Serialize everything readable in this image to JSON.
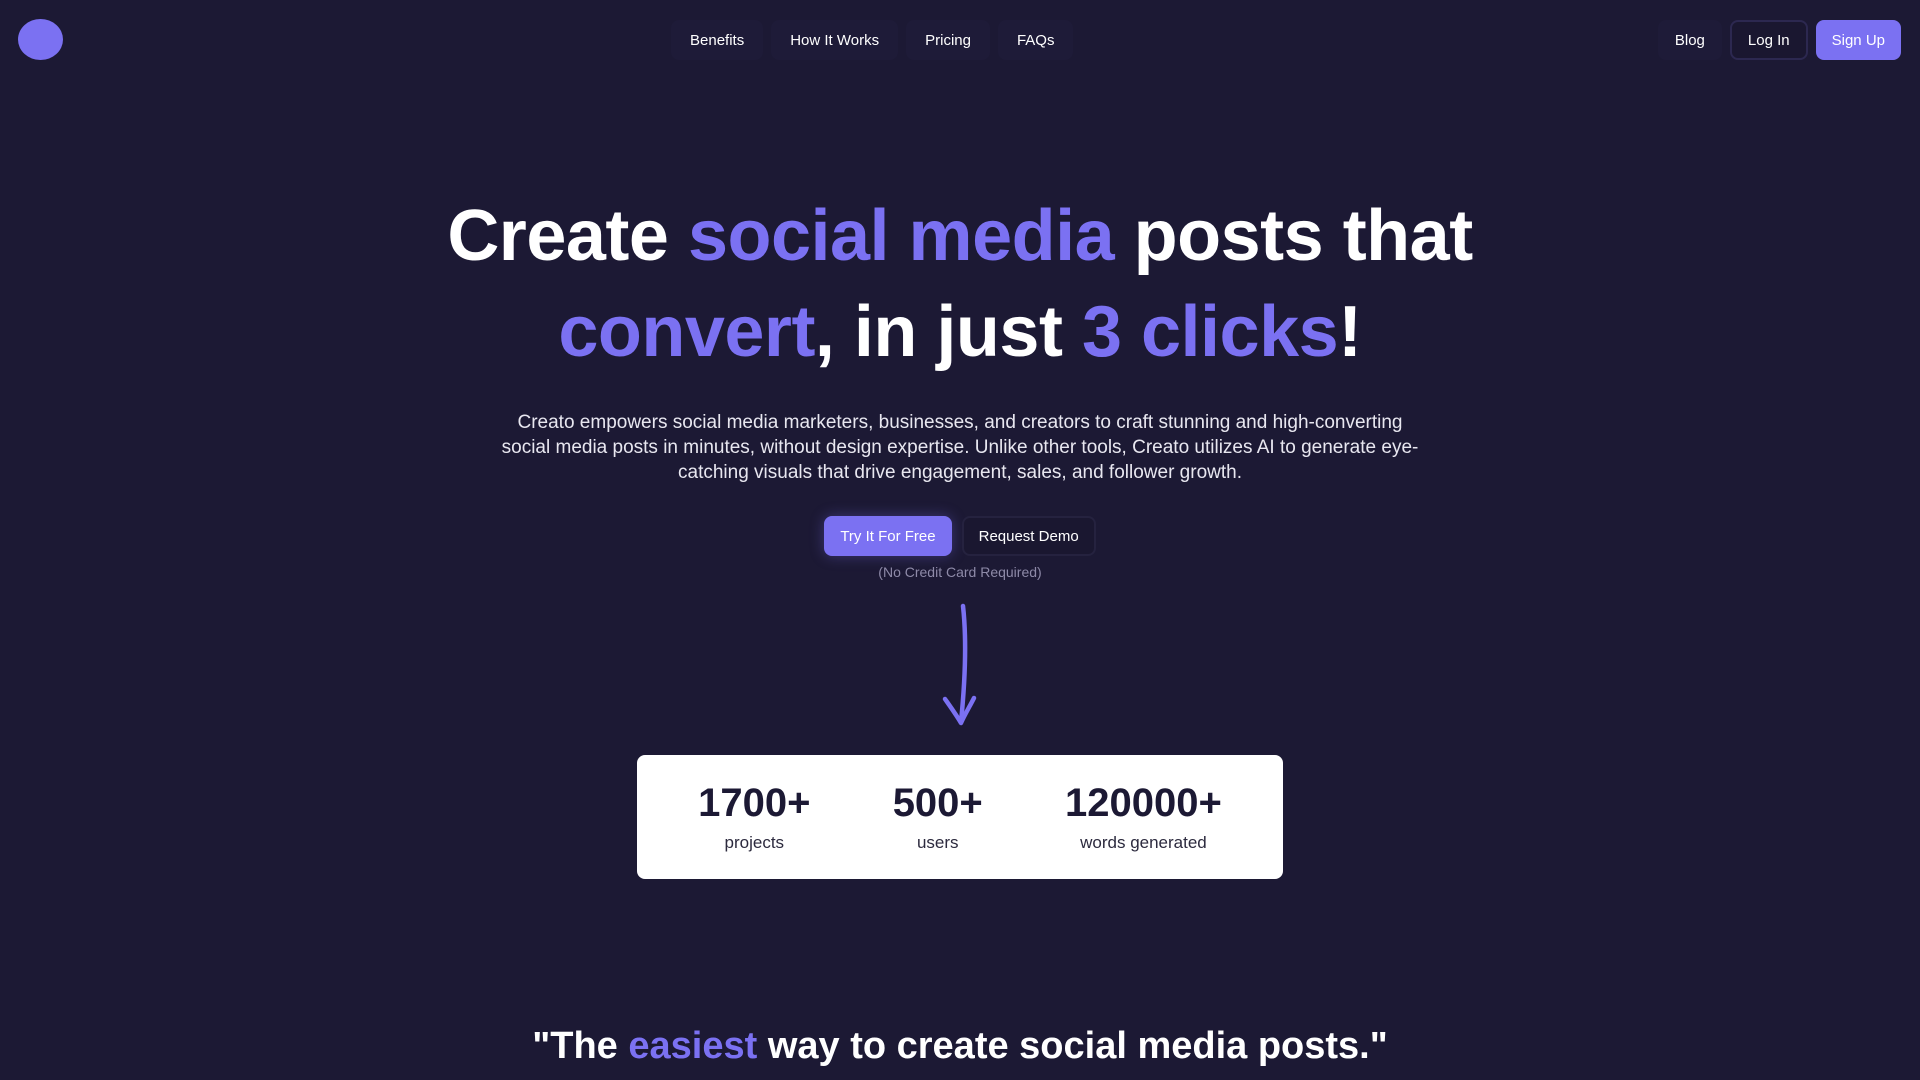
{
  "nav": {
    "links": [
      "Benefits",
      "How It Works",
      "Pricing",
      "FAQs"
    ],
    "blog": "Blog",
    "login": "Log In",
    "signup": "Sign Up"
  },
  "hero": {
    "title_part1": "Create ",
    "title_accent1": "social media",
    "title_part2": " posts that",
    "title_accent2": "convert",
    "title_part3": ", in just ",
    "title_accent3": "3 clicks",
    "title_part4": "!",
    "subtitle": "Creato empowers social media marketers, businesses, and creators to craft stunning and high-converting social media posts in minutes, without design expertise. Unlike other tools, Creato utilizes AI to generate eye-catching visuals that drive engagement, sales, and follower growth.",
    "primary_cta": "Try It For Free",
    "secondary_cta": "Request Demo",
    "note": "(No Credit Card Required)"
  },
  "stats": [
    {
      "value": "1700+",
      "label": "projects"
    },
    {
      "value": "500+",
      "label": "users"
    },
    {
      "value": "120000+",
      "label": "words generated"
    }
  ],
  "quote": {
    "part1": "\"The ",
    "accent": "easiest",
    "part2": " way to create social media posts.\""
  },
  "colors": {
    "background": "#1c1934",
    "accent": "#7b71f2",
    "card": "#ffffff"
  }
}
